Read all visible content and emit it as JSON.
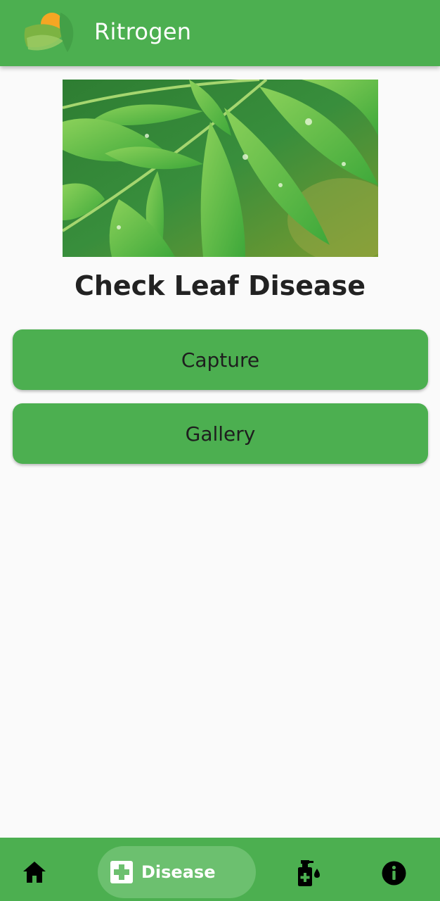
{
  "app_bar": {
    "title": "Ritrogen",
    "logo_icon": "leaf-sun-logo-icon"
  },
  "hero": {
    "image_icon": "neem-leaves-image"
  },
  "main": {
    "title": "Check Leaf Disease",
    "buttons": [
      {
        "label": "Capture"
      },
      {
        "label": "Gallery"
      }
    ]
  },
  "bottom_nav": {
    "items": [
      {
        "icon": "home-icon",
        "label": ""
      },
      {
        "icon": "medical-plus-icon",
        "label": "Disease",
        "active": true
      },
      {
        "icon": "spray-bottle-icon",
        "label": ""
      },
      {
        "icon": "info-icon",
        "label": ""
      }
    ]
  },
  "colors": {
    "primary": "#4caf50",
    "active_pill": "#6cc06f",
    "background": "#fafafa",
    "text_dark": "#222222"
  }
}
